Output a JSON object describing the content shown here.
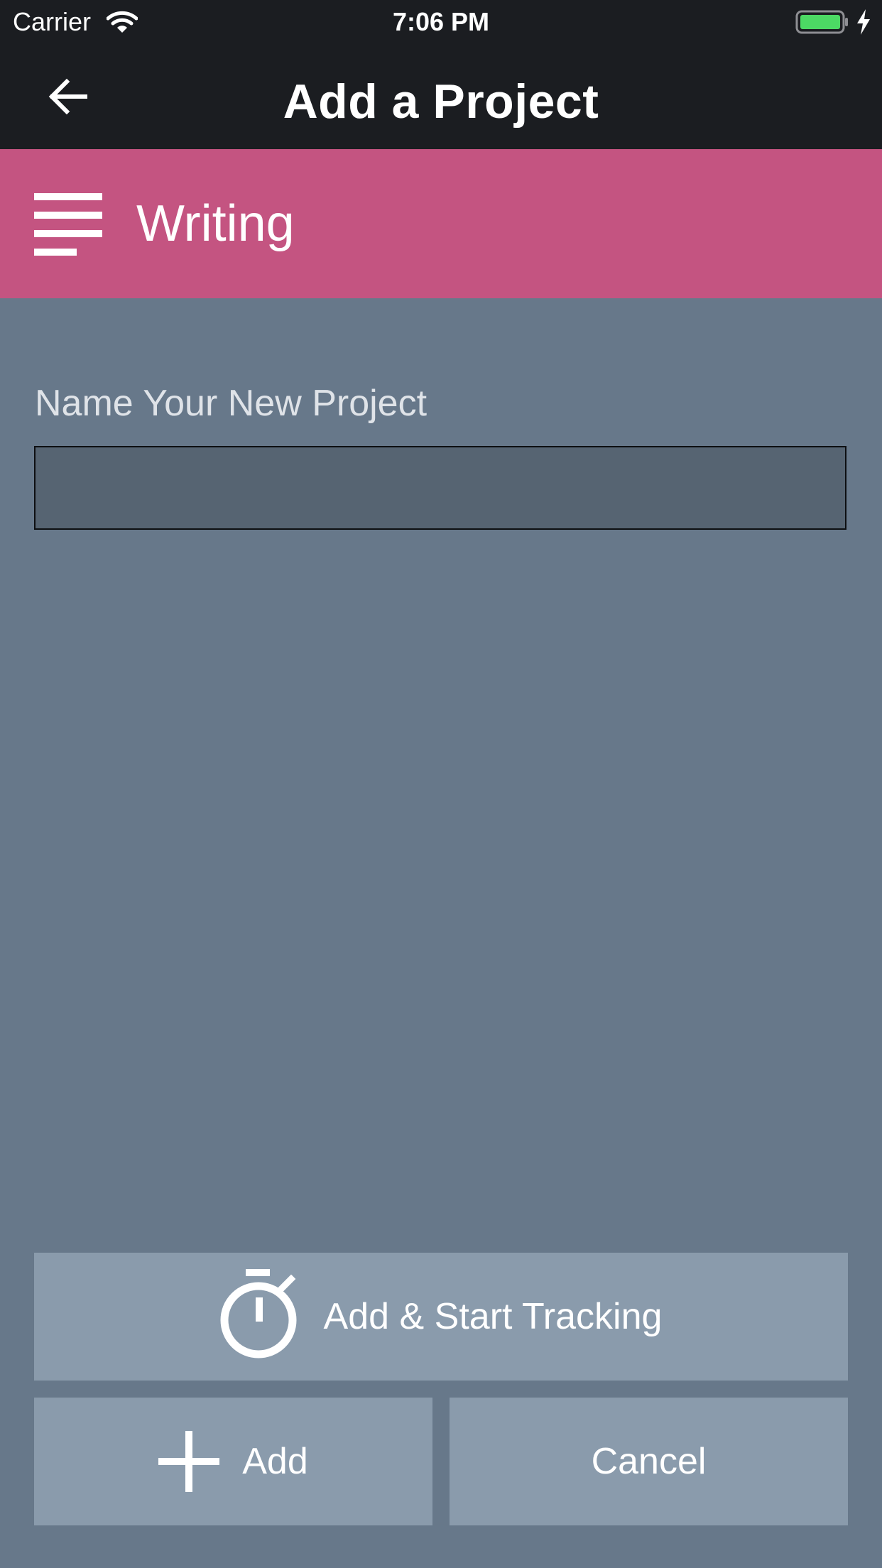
{
  "status_bar": {
    "carrier": "Carrier",
    "time": "7:06 PM",
    "battery_color": "#4cd964"
  },
  "nav_bar": {
    "title": "Add a Project",
    "back_icon": "arrow-left-icon"
  },
  "category": {
    "name": "Writing",
    "icon": "text-lines-icon",
    "color": "#c45481"
  },
  "form": {
    "label": "Name Your New Project",
    "input_value": "",
    "input_placeholder": ""
  },
  "buttons": {
    "add_and_track": {
      "label": "Add & Start Tracking",
      "icon": "stopwatch-icon"
    },
    "add": {
      "label": "Add",
      "icon": "plus-icon"
    },
    "cancel": {
      "label": "Cancel"
    }
  },
  "colors": {
    "background": "#67788a",
    "button": "#8a9bac",
    "header": "#1b1d21"
  }
}
